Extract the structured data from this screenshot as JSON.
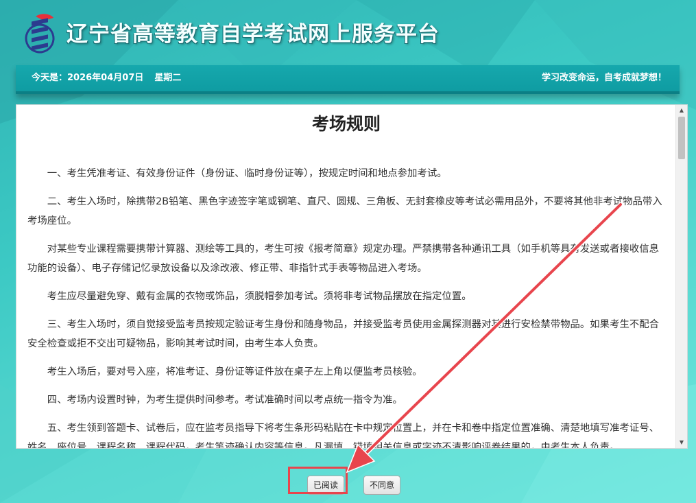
{
  "header": {
    "logo_icon": "exam-logo-icon",
    "site_title": "辽宁省高等教育自学考试网上服务平台"
  },
  "date_bar": {
    "date_text": "今天是：2026年04月07日",
    "weekday": "星期二",
    "slogan": "学习改变命运，自考成就梦想！"
  },
  "rules": {
    "title": "考场规则",
    "paragraphs": [
      "一、考生凭准考证、有效身份证件（身份证、临时身份证等），按规定时间和地点参加考试。",
      "二、考生入场时，除携带2B铅笔、黑色字迹签字笔或钢笔、直尺、圆规、三角板、无封套橡皮等考试必需用品外，不要将其他非考试物品带入考场座位。",
      "对某些专业课程需要携带计算器、测绘等工具的，考生可按《报考简章》规定办理。严禁携带各种通讯工具（如手机等具有发送或者接收信息功能的设备）、电子存储记忆录放设备以及涂改液、修正带、非指针式手表等物品进入考场。",
      "考生应尽量避免穿、戴有金属的衣物或饰品，须脱帽参加考试。须将非考试物品摆放在指定位置。",
      "三、考生入场时，须自觉接受监考员按规定验证考生身份和随身物品，并接受监考员使用金属探测器对其进行安检禁带物品。如果考生不配合安全检查或拒不交出可疑物品，影响其考试时间，由考生本人负责。",
      "考生入场后，要对号入座，将准考证、身份证等证件放在桌子左上角以便监考员核验。",
      "四、考场内设置时钟，为考生提供时间参考。考试准确时间以考点统一指令为准。",
      "五、考生领到答题卡、试卷后，应在监考员指导下将考生条形码粘贴在卡中规定位置上，并在卡和卷中指定位置准确、清楚地填写准考证号、姓名、座位号、课程名称、课程代码，考生笔迹确认内容等信息。凡漏填、错填相关信息或字迹不清影响评卷结果的，由考生本人负责。"
    ]
  },
  "buttons": {
    "agree": "已阅读",
    "disagree": "不同意"
  },
  "scrollbar": {
    "up_icon": "scroll-up-arrow-icon",
    "down_icon": "scroll-down-arrow-icon"
  },
  "annotation": {
    "color": "#e8454d"
  }
}
